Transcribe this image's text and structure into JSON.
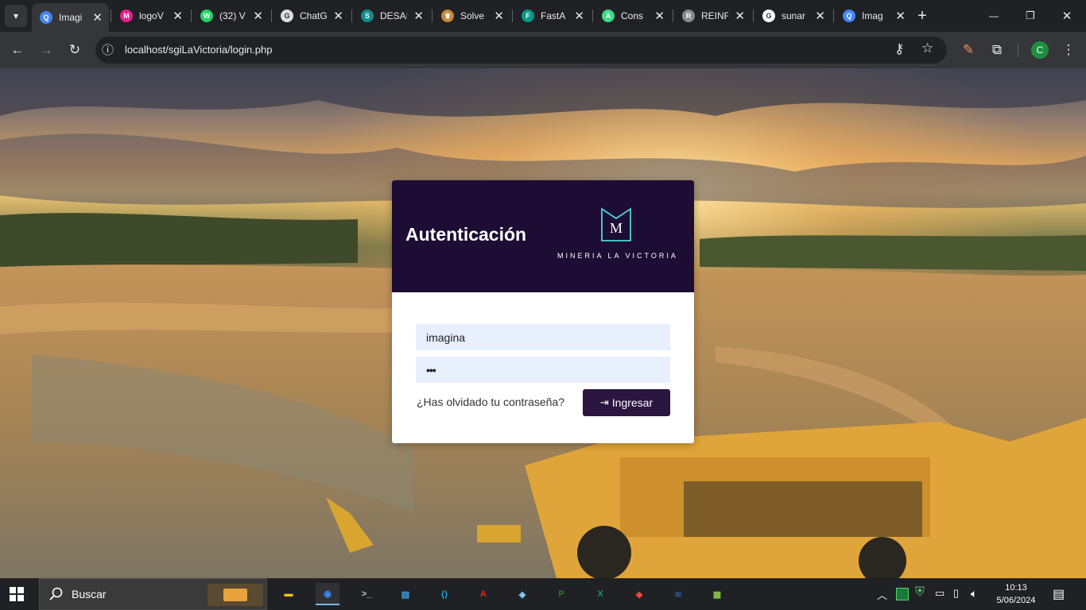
{
  "browser": {
    "tabs": [
      {
        "title": "Imagi",
        "fav": "Q",
        "color": "#4285f4"
      },
      {
        "title": "logoV",
        "fav": "M",
        "color": "#e91e8c"
      },
      {
        "title": "(32) V",
        "fav": "W",
        "color": "#25d366"
      },
      {
        "title": "ChatG",
        "fav": "G",
        "color": "#dddddd"
      },
      {
        "title": "DESAI",
        "fav": "S",
        "color": "#128c8c"
      },
      {
        "title": "Solve",
        "fav": "♛",
        "color": "#c58a3a"
      },
      {
        "title": "FastA",
        "fav": "F",
        "color": "#05998b"
      },
      {
        "title": "Cons",
        "fav": "A",
        "color": "#3ddc84"
      },
      {
        "title": "REINF",
        "fav": "R",
        "color": "#8a8a8a"
      },
      {
        "title": "sunar",
        "fav": "G",
        "color": "#ffffff"
      },
      {
        "title": "Imag",
        "fav": "Q",
        "color": "#4285f4"
      }
    ],
    "url": "localhost/sgiLaVictoria/login.php",
    "profile_initial": "C",
    "icons": {
      "tab_search": "▾",
      "new_tab": "+",
      "minimize": "—",
      "restore": "❐",
      "close": "✕",
      "back": "←",
      "forward": "→",
      "reload": "↻",
      "site_info": "ⓘ",
      "passwords": "⚷",
      "bookmark": "☆",
      "extensions": "⧉",
      "pen": "✎",
      "menu": "⋮"
    }
  },
  "login": {
    "title": "Autenticación",
    "logo_mark": "M",
    "brand": "MINERIA LA VICTORIA",
    "username_value": "imagina",
    "password_value": "•••",
    "forgot_label": "¿Has olvidado tu contraseña?",
    "submit_icon": "⇥",
    "submit_label": "Ingresar",
    "colors": {
      "header": "#1d0c33",
      "button": "#2b1640",
      "input": "#e8f0fe",
      "logo": "#4dd5d8"
    }
  },
  "taskbar": {
    "search_placeholder": "Buscar",
    "apps": [
      {
        "name": "file-explorer",
        "glyph": "▬",
        "color": "#f5c518"
      },
      {
        "name": "chrome",
        "glyph": "◉",
        "color": "#4285f4"
      },
      {
        "name": "terminal",
        "glyph": ">_",
        "color": "#cccccc"
      },
      {
        "name": "control-panel",
        "glyph": "▤",
        "color": "#3ba3e6"
      },
      {
        "name": "vscode",
        "glyph": "⟨⟩",
        "color": "#23a9f2"
      },
      {
        "name": "acrobat",
        "glyph": "A",
        "color": "#e1251b"
      },
      {
        "name": "notes",
        "glyph": "◈",
        "color": "#7fd3f0"
      },
      {
        "name": "project",
        "glyph": "P",
        "color": "#31752f"
      },
      {
        "name": "excel",
        "glyph": "X",
        "color": "#1f9d55"
      },
      {
        "name": "anydesk",
        "glyph": "◆",
        "color": "#ef443b"
      },
      {
        "name": "mysql",
        "glyph": "≋",
        "color": "#2a5c8f"
      },
      {
        "name": "notepad",
        "glyph": "▦",
        "color": "#8bc34a"
      }
    ],
    "clock_time": "10:13",
    "clock_date": "5/06/2024"
  }
}
